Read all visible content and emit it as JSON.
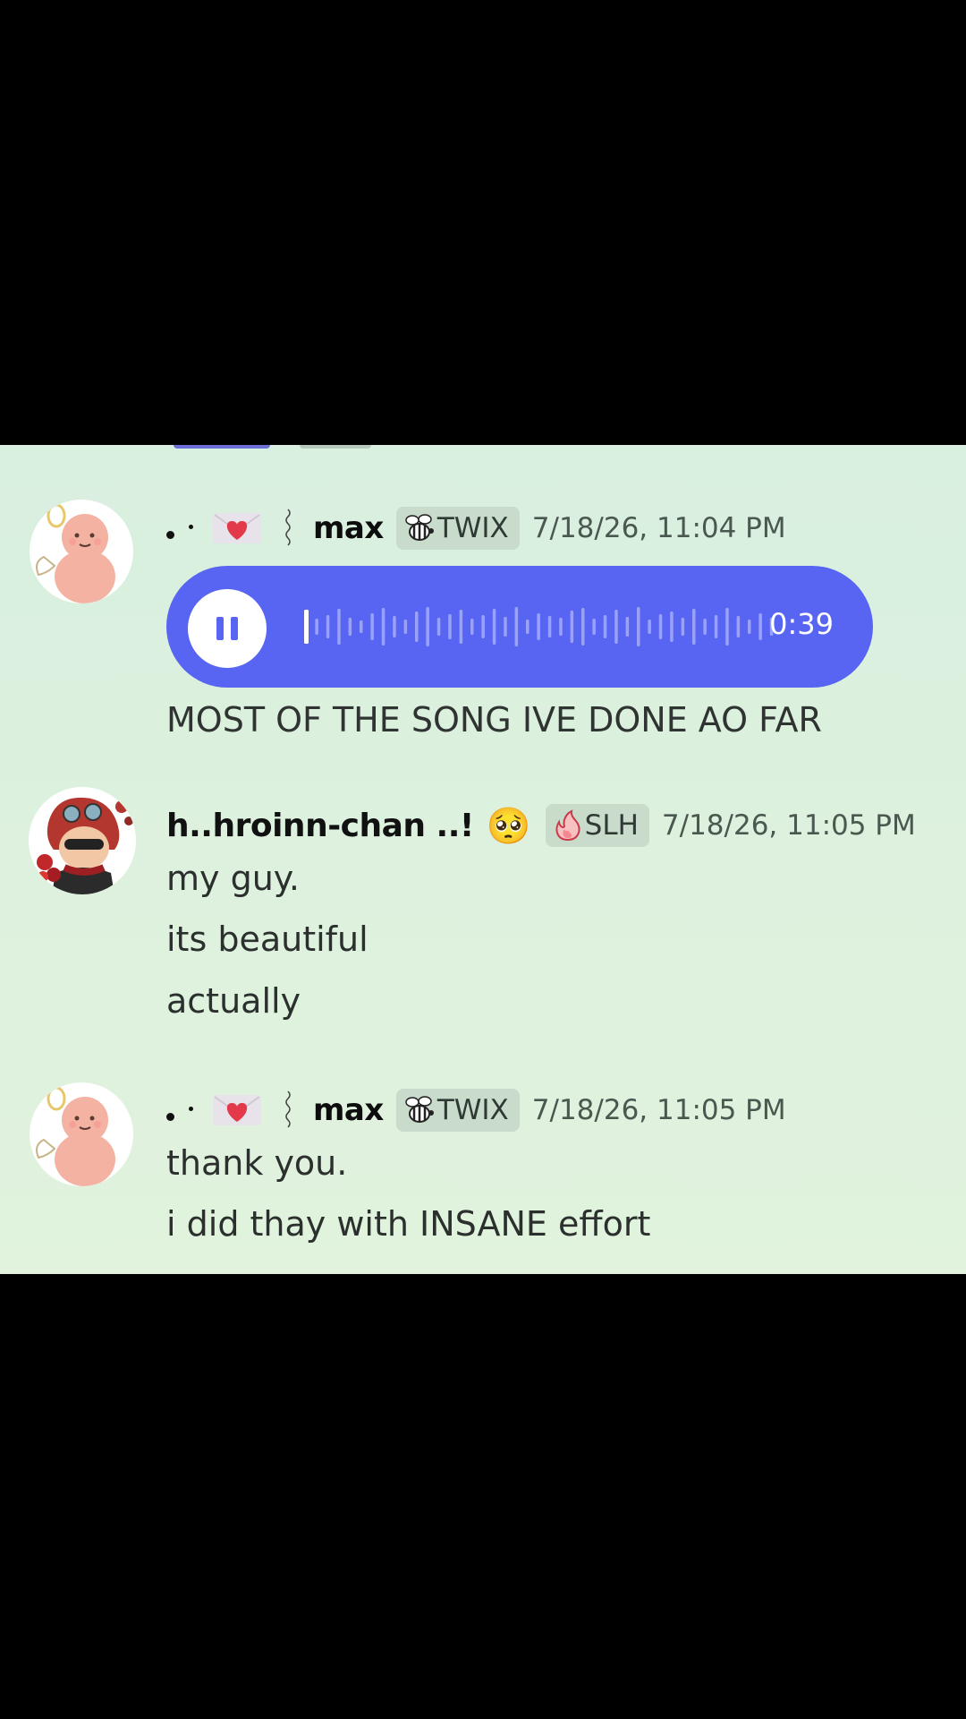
{
  "messages": [
    {
      "username": "max",
      "tag": "TWIX",
      "tag_icon": "bee-icon",
      "timestamp": "7/18/26, 11:04 PM",
      "voice": {
        "duration": "0:39",
        "state": "playing",
        "progress": 0.02
      },
      "lines": [
        "MOST OF THE SONG IVE DONE AO FAR"
      ]
    },
    {
      "username": "h..hroinn-chan ..!",
      "username_emoji": "🥺",
      "tag": "SLH",
      "tag_icon": "flame-icon",
      "timestamp": "7/18/26, 11:05 PM",
      "lines": [
        "my guy.",
        "its beautiful",
        "actually"
      ]
    },
    {
      "username": "max",
      "tag": "TWIX",
      "tag_icon": "bee-icon",
      "timestamp": "7/18/26, 11:05 PM",
      "lines": [
        "thank you.",
        "i did thay with INSANE effort"
      ]
    }
  ],
  "colors": {
    "chat_background": "#dcf0de",
    "voice_accent": "#5865f2",
    "tag_background": "#c9dbcb"
  }
}
